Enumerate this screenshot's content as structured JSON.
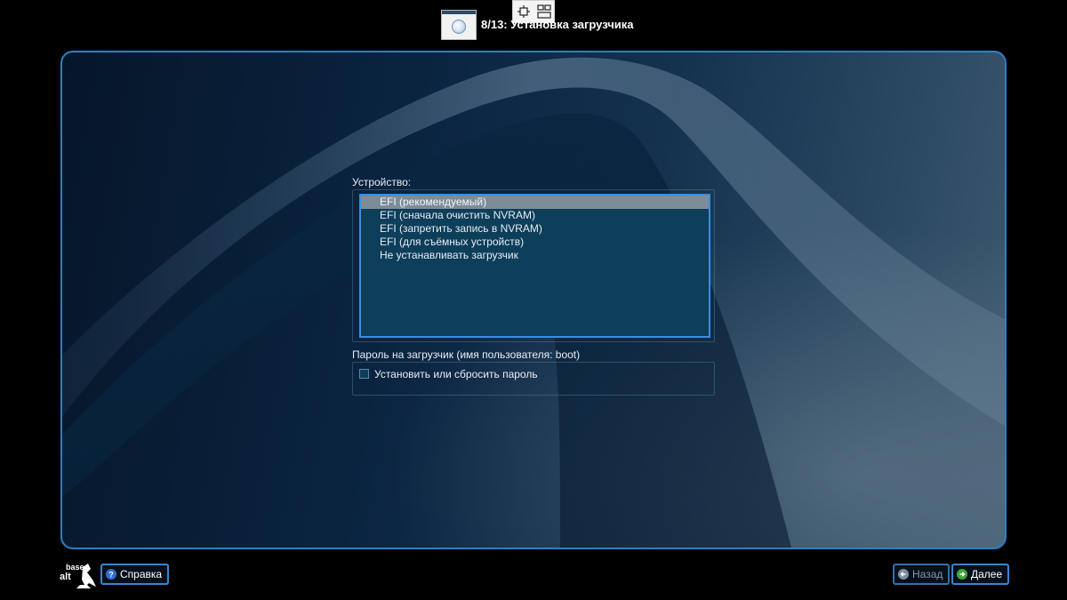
{
  "window": {
    "title": "8/13: Установка загрузчика"
  },
  "bootloader": {
    "device_label": "Устройство:",
    "device_options": [
      "EFI (рекомендуемый)",
      "EFI (сначала очистить NVRAM)",
      "EFI (запретить запись в NVRAM)",
      "EFI (для съёмных устройств)",
      "Не устанавливать загрузчик"
    ],
    "selected_index": 0,
    "password_label": "Пароль на загрузчик (имя пользователя: boot)",
    "password_checkbox_label": "Установить или сбросить пароль",
    "password_checkbox_checked": false
  },
  "footer": {
    "logo_line1": "base",
    "logo_line2": "alt",
    "help_label": "Справка",
    "back_label": "Назад",
    "back_enabled": false,
    "next_label": "Далее"
  },
  "icons": {
    "title_app": "installer-window-icon",
    "tool1": "move-window-icon",
    "tool2": "window-layout-icon",
    "help": "help-icon",
    "back": "arrow-left-icon",
    "next": "arrow-right-icon"
  },
  "colors": {
    "accent": "#3a8ee0",
    "list_background": "#0d3e5a",
    "selection": "#7d8d98"
  }
}
